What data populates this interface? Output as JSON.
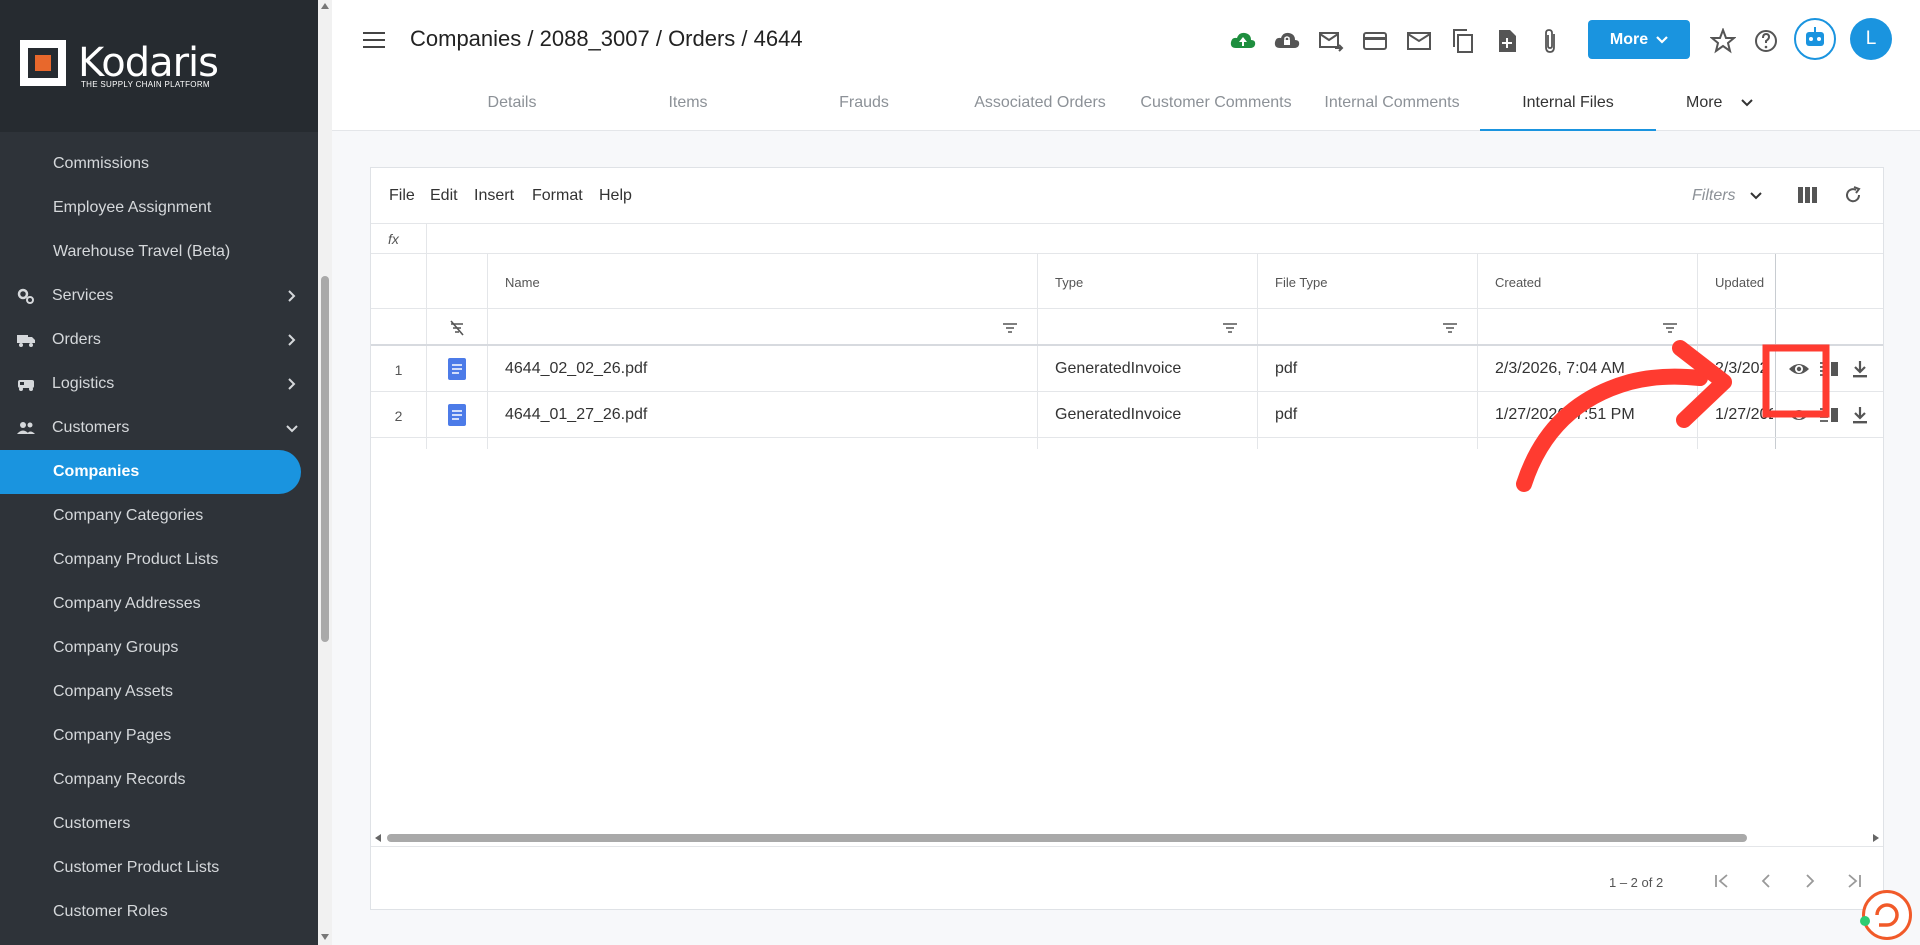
{
  "brand": {
    "name": "Kodaris",
    "tagline": "THE SUPPLY CHAIN PLATFORM",
    "accent_color": "#1a94df",
    "sidebar_bg": "#2e3339",
    "annotation_color": "#ff3b30"
  },
  "sidebar": {
    "items": [
      {
        "label": "Commissions",
        "kind": "sub"
      },
      {
        "label": "Employee Assignment",
        "kind": "sub"
      },
      {
        "label": "Warehouse Travel (Beta)",
        "kind": "sub"
      },
      {
        "label": "Services",
        "kind": "parent",
        "icon": "gears-icon",
        "chevron": "right"
      },
      {
        "label": "Orders",
        "kind": "parent",
        "icon": "truck-icon",
        "chevron": "right"
      },
      {
        "label": "Logistics",
        "kind": "parent",
        "icon": "vehicle-icon",
        "chevron": "right"
      },
      {
        "label": "Customers",
        "kind": "parent",
        "icon": "people-icon",
        "chevron": "down"
      },
      {
        "label": "Companies",
        "kind": "sub",
        "active": true
      },
      {
        "label": "Company Categories",
        "kind": "sub"
      },
      {
        "label": "Company Product Lists",
        "kind": "sub"
      },
      {
        "label": "Company Addresses",
        "kind": "sub"
      },
      {
        "label": "Company Groups",
        "kind": "sub"
      },
      {
        "label": "Company Assets",
        "kind": "sub"
      },
      {
        "label": "Company Pages",
        "kind": "sub"
      },
      {
        "label": "Company Records",
        "kind": "sub"
      },
      {
        "label": "Customers",
        "kind": "sub"
      },
      {
        "label": "Customer Product Lists",
        "kind": "sub"
      },
      {
        "label": "Customer Roles",
        "kind": "sub"
      }
    ]
  },
  "header": {
    "breadcrumb": "Companies / 2088_3007 / Orders / 4644",
    "more_label": "More",
    "avatar_initial": "L",
    "icons": [
      "cloud-upload-icon",
      "cloud-lock-icon",
      "mail-forward-icon",
      "credit-card-icon",
      "mail-icon",
      "copy-icon",
      "file-add-icon",
      "attachment-icon",
      "star-icon",
      "help-icon",
      "bot-icon"
    ]
  },
  "tabs": {
    "items": [
      "Details",
      "Items",
      "Frauds",
      "Associated Orders",
      "Customer Comments",
      "Internal Comments",
      "Internal Files"
    ],
    "active": "Internal Files",
    "more_label": "More"
  },
  "toolbar": {
    "menus": [
      "File",
      "Edit",
      "Insert",
      "Format",
      "Help"
    ],
    "filters_label": "Filters",
    "fx_label": "fx"
  },
  "grid": {
    "columns": [
      "Name",
      "Type",
      "File Type",
      "Created",
      "Updated"
    ],
    "rows": [
      {
        "num": "1",
        "name": "4644_02_02_26.pdf",
        "type": "GeneratedInvoice",
        "file_type": "pdf",
        "created": "2/3/2026, 7:04 AM",
        "updated": "2/3/202"
      },
      {
        "num": "2",
        "name": "4644_01_27_26.pdf",
        "type": "GeneratedInvoice",
        "file_type": "pdf",
        "created": "1/27/2026, 7:51 PM",
        "updated": "1/27/202"
      }
    ],
    "row_actions": [
      "view-icon",
      "columns-icon",
      "download-icon"
    ]
  },
  "pager": {
    "text": "1 – 2 of 2"
  }
}
